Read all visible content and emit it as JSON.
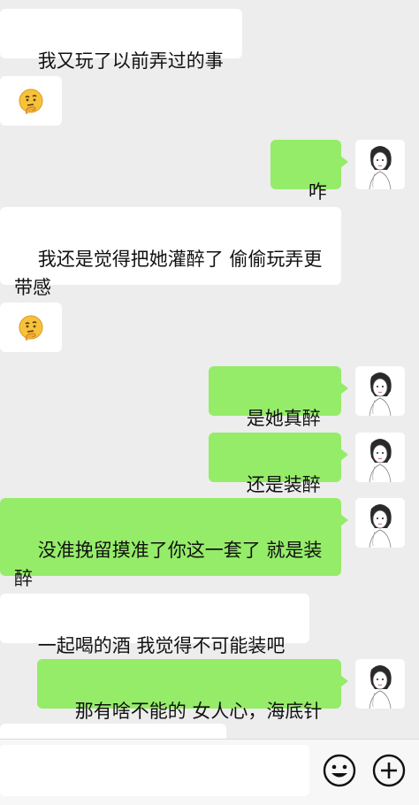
{
  "messages": [
    {
      "side": "in",
      "type": "text",
      "text": "我又玩了以前弄过的事"
    },
    {
      "side": "in",
      "type": "emoji",
      "icon": "thinking-face-icon"
    },
    {
      "side": "out",
      "type": "text",
      "text": "咋说"
    },
    {
      "side": "in",
      "type": "text",
      "text": "我还是觉得把她灌醉了 偷偷玩弄更带感"
    },
    {
      "side": "in",
      "type": "emoji",
      "icon": "thinking-face-icon"
    },
    {
      "side": "out",
      "type": "text",
      "text": "是她真醉啊"
    },
    {
      "side": "out",
      "type": "text",
      "text": "还是装醉啊"
    },
    {
      "side": "out",
      "type": "text",
      "text": "没准挽留摸准了你这一套了 就是装醉"
    },
    {
      "side": "in",
      "type": "text",
      "text": "一起喝的酒 我觉得不可能装吧"
    },
    {
      "side": "out",
      "type": "text",
      "text": "那有啥不能的 女人心，海底针"
    }
  ],
  "input_bar": {
    "input_value": "",
    "emoji_button_icon": "smiley-icon",
    "more_button_icon": "plus-circle-icon"
  },
  "colors": {
    "background": "#ededed",
    "incoming_bubble": "#ffffff",
    "outgoing_bubble": "#95ec69"
  }
}
